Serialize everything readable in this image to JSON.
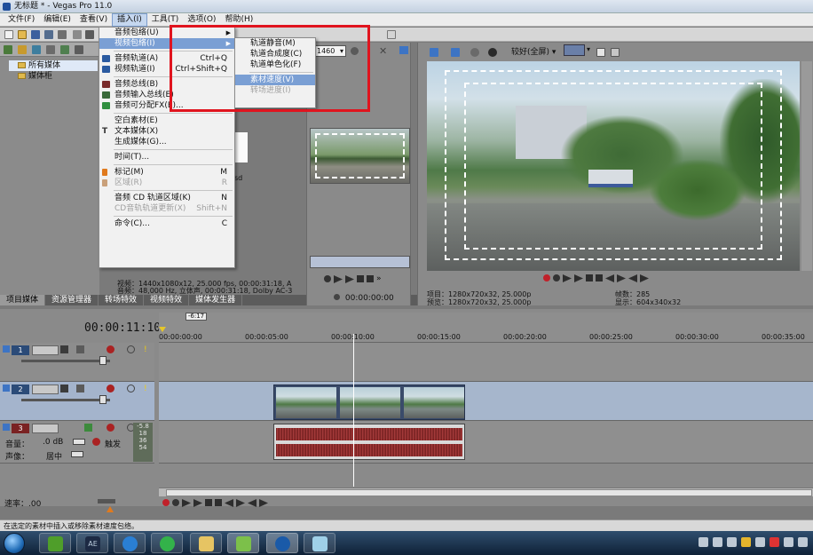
{
  "window": {
    "title": "无标题 * - Vegas Pro 11.0"
  },
  "menubar": [
    "文件(F)",
    "编辑(E)",
    "查看(V)",
    "插入(I)",
    "工具(T)",
    "选项(O)",
    "帮助(H)"
  ],
  "insert_menu": {
    "items": [
      {
        "label": "音频包络(U)",
        "submenu": true
      },
      {
        "label": "视频包络(I)",
        "submenu": true,
        "highlighted": true
      },
      {
        "label": "音频轨道(A)",
        "shortcut": "Ctrl+Q"
      },
      {
        "label": "视频轨道(I)",
        "shortcut": "Ctrl+Shift+Q"
      },
      {
        "label": "音频总线(B)"
      },
      {
        "label": "音频输入总线(E)"
      },
      {
        "label": "音频可分配FX(E)..."
      },
      {
        "label": "空白素材(E)"
      },
      {
        "label": "文本媒体(X)"
      },
      {
        "label": "生成媒体(G)..."
      },
      {
        "label": "时间(T)..."
      },
      {
        "label": "标记(M)",
        "shortcut": "M"
      },
      {
        "label": "区域(R)",
        "shortcut": "R",
        "disabled": true
      },
      {
        "label": "音频 CD 轨道区域(K)",
        "shortcut": "N"
      },
      {
        "label": "CD音轨轨道更新(X)",
        "shortcut": "Shift+N",
        "disabled": true
      },
      {
        "label": "命令(C)...",
        "shortcut": "C"
      }
    ]
  },
  "video_envelope_submenu": {
    "items": [
      {
        "label": "轨道静音(M)"
      },
      {
        "label": "轨道合成度(C)"
      },
      {
        "label": "轨道单色化(F)"
      },
      {
        "label": "素材速度(V)",
        "highlighted": true
      },
      {
        "label": "转场进度(I)",
        "disabled": true
      }
    ]
  },
  "media_tree": {
    "items": [
      "所有媒体",
      "媒体柜"
    ]
  },
  "media_info": {
    "video": "视频：1440x1080x12, 25.000 fps, 00:00:31:18, A",
    "audio": "音频：48,000 Hz, 立体声, 00:00:31:18, Dolby AC-3",
    "partial_sd": "sd"
  },
  "bottom_tabs": [
    "项目媒体",
    "资源管理器",
    "转场特效",
    "视频特效",
    "媒体发生器"
  ],
  "trimmer": {
    "timecode": "00:00:00:00",
    "zoom": "1460"
  },
  "preview": {
    "quality": "较好(全屏)",
    "project_label": "项目：1280x720x32, 25.000p",
    "preview_label": "预览：1280x720x32, 25.000p",
    "frame_label": "帧数：285",
    "display_label": "显示：604x340x32"
  },
  "timeline": {
    "timecode": "00:00:11:10",
    "badge": "-6:17",
    "ruler": [
      "00:00:00:00",
      "00:00:05:00",
      "00:00:10:00",
      "00:00:15:00",
      "00:00:20:00",
      "00:00:25:00",
      "00:00:30:00",
      "00:00:35:00"
    ],
    "tracks": [
      {
        "num": "1",
        "kind": "video"
      },
      {
        "num": "2",
        "kind": "video"
      },
      {
        "num": "3",
        "kind": "audio",
        "volume_label": "音量：",
        "volume_value": ".0 dB",
        "pan_label": "声像：",
        "pan_value": "居中",
        "trigger": "触发",
        "meter": [
          "-5.8",
          "18",
          "36",
          "54"
        ]
      }
    ],
    "rate_label": "速率：.00"
  },
  "status_bar": "在选定的素材中插入或移除素材速度包络。",
  "taskbar": {
    "ae_label": "AE"
  }
}
